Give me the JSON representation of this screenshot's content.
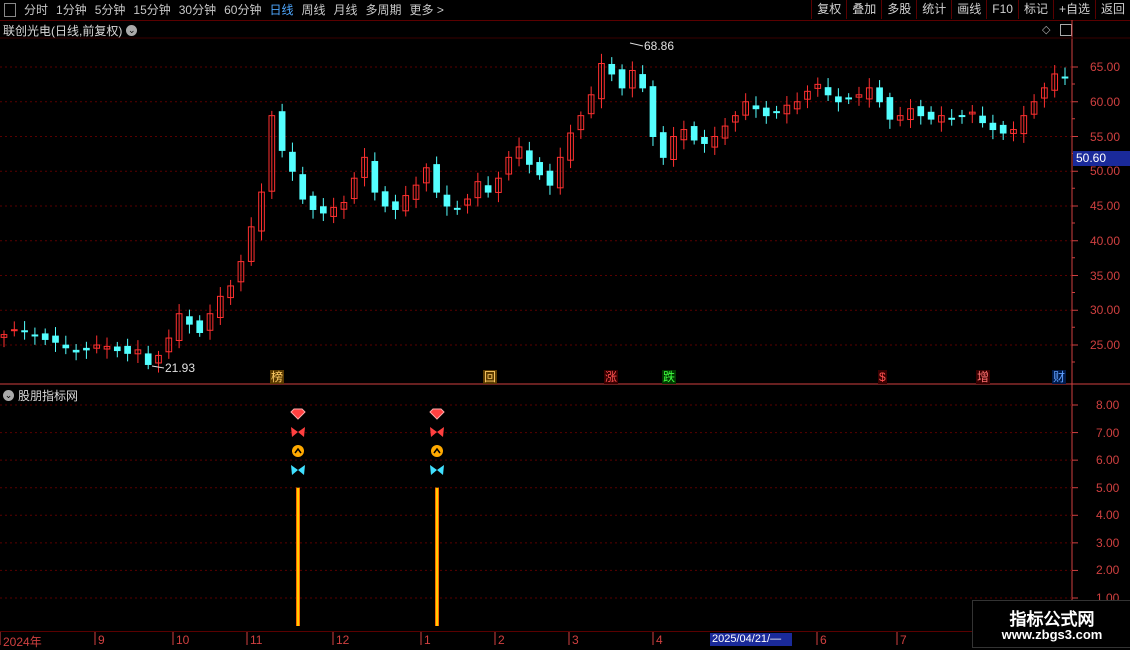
{
  "toolbar": {
    "periods": [
      "分时",
      "1分钟",
      "5分钟",
      "15分钟",
      "30分钟",
      "60分钟",
      "日线",
      "周线",
      "月线",
      "多周期",
      "更多 >"
    ],
    "active_period": "日线",
    "buttons": [
      "复权",
      "叠加",
      "多股",
      "统计",
      "画线",
      "F10",
      "标记",
      "+自选",
      "返回"
    ]
  },
  "main_chart": {
    "title": "联创光电(日线,前复权)",
    "current_price": "50.60",
    "high_label": "68.86",
    "low_label": "21.93",
    "price_ticks": [
      "65.00",
      "60.00",
      "55.00",
      "50.00",
      "45.00",
      "40.00",
      "35.00",
      "30.00",
      "25.00"
    ],
    "events": [
      {
        "text": "榜",
        "color": "#ffcc66",
        "bg": "#5a3a00"
      },
      {
        "text": "回",
        "color": "#ffcc66",
        "bg": "#5a3a00"
      },
      {
        "text": "涨",
        "color": "#ff5050",
        "bg": "#3a0000"
      },
      {
        "text": "跌",
        "color": "#40ff40",
        "bg": "#003a00"
      },
      {
        "text": "$",
        "color": "#ff5050",
        "bg": "#3a0000"
      },
      {
        "text": "增",
        "color": "#ff7070",
        "bg": "#3a0000"
      },
      {
        "text": "财",
        "color": "#60a0ff",
        "bg": "#001a4a"
      }
    ],
    "colors": {
      "up": "#ff3030",
      "down": "#54ffff",
      "grid": "#5a0000",
      "axis": "#d04040"
    }
  },
  "indicator": {
    "title": "股朋指标网",
    "ticks": [
      "8.00",
      "7.00",
      "6.00",
      "5.00",
      "4.00",
      "3.00",
      "2.00",
      "1.00"
    ]
  },
  "date_axis": {
    "labels": [
      "2024年",
      "9",
      "10",
      "11",
      "12",
      "1",
      "2",
      "3",
      "4",
      "6",
      "7"
    ],
    "selected": "2025/04/21/—"
  },
  "watermark": {
    "line1": "指标公式网",
    "line2": "www.zbgs3.com"
  },
  "chart_data": {
    "type": "candlestick",
    "title": "联创光电(日线,前复权)",
    "ylim": [
      21,
      69
    ],
    "close_series_approx": [
      26.5,
      27.2,
      27.0,
      26.3,
      25.8,
      25.4,
      24.6,
      24.0,
      24.3,
      25.0,
      24.8,
      24.2,
      23.8,
      24.3,
      22.2,
      23.5,
      26.0,
      29.5,
      28.0,
      26.8,
      29.5,
      32.0,
      33.5,
      37.0,
      42.0,
      47.0,
      58.0,
      53.0,
      50.0,
      46.0,
      44.5,
      44.0,
      44.8,
      45.5,
      49.0,
      52.0,
      47.0,
      45.0,
      44.5,
      46.5,
      48.0,
      50.5,
      47.0,
      45.0,
      44.6,
      46.0,
      48.5,
      47.0,
      49.0,
      52.0,
      53.5,
      51.0,
      49.5,
      48.0,
      52.0,
      55.5,
      58.0,
      61.0,
      65.5,
      64.0,
      62.0,
      64.5,
      62.0,
      55.0,
      52.0,
      55.0,
      56.0,
      54.5,
      54.0,
      55.0,
      56.5,
      58.0,
      60.0,
      59.0,
      58.0,
      58.5,
      59.5,
      60.0,
      61.5,
      62.5,
      61.0,
      60.0,
      60.5,
      61.0,
      62.0,
      60.0,
      57.5,
      58.0,
      59.0,
      58.0,
      57.5,
      58.0,
      57.5,
      58.0,
      58.5,
      57.0,
      56.0,
      55.5,
      56.0,
      58.0,
      60.0,
      62.0,
      64.0,
      63.5
    ],
    "indicator_signals": [
      {
        "date": "2024-11",
        "value": 5.0,
        "icons": [
          "diamond",
          "butterfly-red",
          "chevron-up",
          "butterfly-cyan"
        ]
      },
      {
        "date": "2025-01",
        "value": 5.0,
        "icons": [
          "diamond",
          "butterfly-red",
          "chevron-up",
          "butterfly-cyan"
        ]
      }
    ],
    "indicator_ylim": [
      0,
      8.5
    ],
    "grid": true
  }
}
